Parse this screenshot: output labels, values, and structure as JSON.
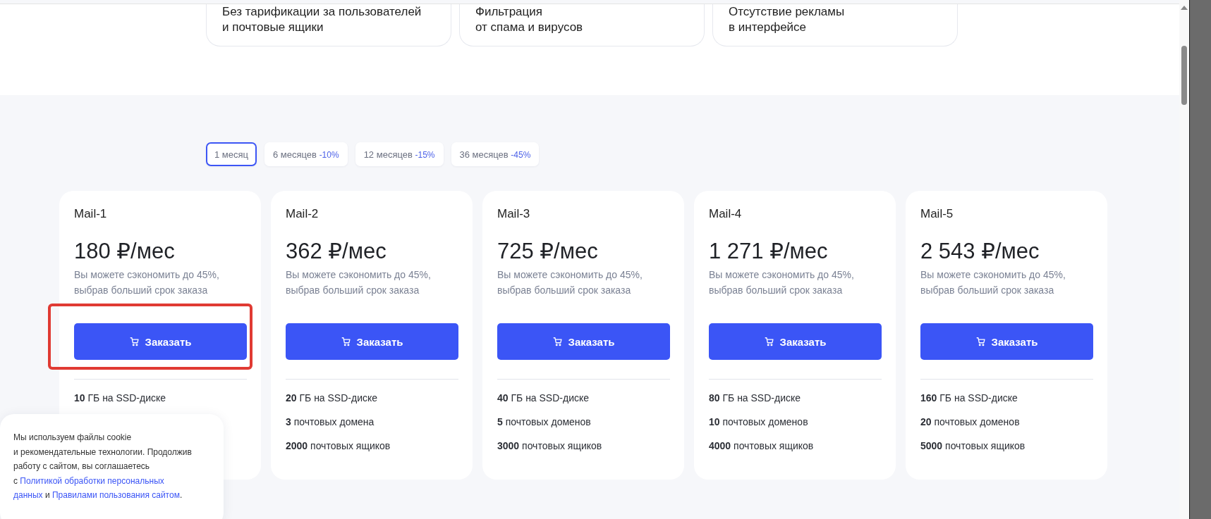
{
  "benefits": [
    {
      "text": "Без тарификации за пользователей\nи почтовые ящики"
    },
    {
      "text": "Фильтрация\nот спама и вирусов"
    },
    {
      "text": "Отсутствие рекламы\nв интерфейсе"
    }
  ],
  "periods": [
    {
      "label": "1 месяц",
      "selected": true
    },
    {
      "label": "6 месяцев",
      "discount": "-10%",
      "selected": false
    },
    {
      "label": "12 месяцев",
      "discount": "-15%",
      "selected": false
    },
    {
      "label": "36 месяцев",
      "discount": "-45%",
      "selected": false
    }
  ],
  "plans": [
    {
      "name": "Mail-1",
      "price": "180 ₽/мес",
      "note": "Вы можете сэкономить до 45%,\nвыбрав больший срок заказа",
      "button": "Заказать",
      "highlighted": true,
      "features": [
        "**10** ГБ на SSD-диске"
      ]
    },
    {
      "name": "Mail-2",
      "price": "362 ₽/мес",
      "note": "Вы можете сэкономить до 45%,\nвыбрав больший срок заказа",
      "button": "Заказать",
      "highlighted": false,
      "features": [
        "**20** ГБ на SSD-диске",
        "**3** почтовых домена",
        "**2000** почтовых ящиков"
      ]
    },
    {
      "name": "Mail-3",
      "price": "725 ₽/мес",
      "note": "Вы можете сэкономить до 45%,\nвыбрав больший срок заказа",
      "button": "Заказать",
      "highlighted": false,
      "features": [
        "**40** ГБ на SSD-диске",
        "**5** почтовых доменов",
        "**3000** почтовых ящиков"
      ]
    },
    {
      "name": "Mail-4",
      "price": "1 271 ₽/мес",
      "note": "Вы можете сэкономить до 45%,\nвыбрав больший срок заказа",
      "button": "Заказать",
      "highlighted": false,
      "features": [
        "**80** ГБ на SSD-диске",
        "**10** почтовых доменов",
        "**4000** почтовых ящиков"
      ]
    },
    {
      "name": "Mail-5",
      "price": "2 543 ₽/мес",
      "note": "Вы можете сэкономить до 45%,\nвыбрав больший срок заказа",
      "button": "Заказать",
      "highlighted": false,
      "features": [
        "**160** ГБ на SSD-диске",
        "**20** почтовых доменов",
        "**5000** почтовых ящиков"
      ]
    }
  ],
  "cookie_banner": {
    "text": "Мы используем файлы cookie\nи рекомендательные технологии. Продолжив\nработу с сайтом, вы соглашаетесь\nс ",
    "link_1": "Политикой обработки персональных\nданных",
    "joiner": " и ",
    "link_2": "Правилами пользования сайтом",
    "end": "."
  }
}
